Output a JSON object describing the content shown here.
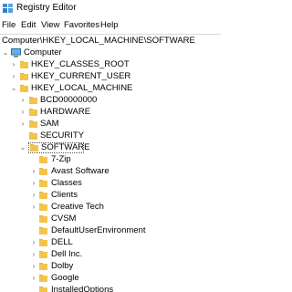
{
  "window": {
    "title": "Registry Editor"
  },
  "menu": [
    "File",
    "Edit",
    "View",
    "Favorites",
    "Help"
  ],
  "address": {
    "value": "Computer\\HKEY_LOCAL_MACHINE\\SOFTWARE"
  },
  "tree": {
    "root": "Computer",
    "hives": [
      "HKEY_CLASSES_ROOT",
      "HKEY_CURRENT_USER",
      "HKEY_LOCAL_MACHINE"
    ],
    "hklm_children": [
      "BCD00000000",
      "HARDWARE",
      "SAM",
      "SECURITY",
      "SOFTWARE"
    ],
    "software_children": [
      "7-Zip",
      "Avast Software",
      "Classes",
      "Clients",
      "Creative Tech",
      "CVSM",
      "DefaultUserEnvironment",
      "DELL",
      "Dell Inc.",
      "Dolby",
      "Google",
      "InstalledOptions"
    ]
  },
  "colors": {
    "folder": "#f3c44a",
    "selection_border": "#555555",
    "chevron": "#6b6b6b"
  },
  "icons": {
    "expanded": "chevron-down-icon",
    "collapsed": "chevron-right-icon"
  }
}
